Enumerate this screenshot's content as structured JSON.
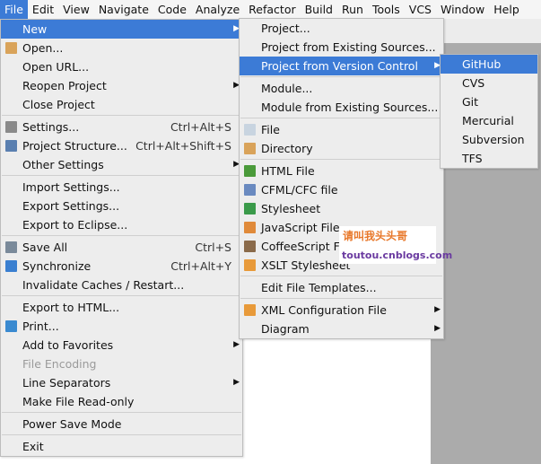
{
  "menubar": [
    "File",
    "Edit",
    "View",
    "Navigate",
    "Code",
    "Analyze",
    "Refactor",
    "Build",
    "Run",
    "Tools",
    "VCS",
    "Window",
    "Help"
  ],
  "active_menu": "File",
  "colors": {
    "selection": "#3c7bd6",
    "menu_bg": "#ededed"
  },
  "file_menu": [
    {
      "label": "New",
      "submenu": true,
      "selected": true
    },
    {
      "label": "Open...",
      "icon": "folder-icon"
    },
    {
      "label": "Open URL..."
    },
    {
      "label": "Reopen Project",
      "submenu": true
    },
    {
      "label": "Close Project"
    },
    {
      "sep": true
    },
    {
      "label": "Settings...",
      "icon": "wrench-icon",
      "shortcut": "Ctrl+Alt+S"
    },
    {
      "label": "Project Structure...",
      "icon": "project-structure-icon",
      "shortcut": "Ctrl+Alt+Shift+S"
    },
    {
      "label": "Other Settings",
      "submenu": true
    },
    {
      "sep": true
    },
    {
      "label": "Import Settings..."
    },
    {
      "label": "Export Settings..."
    },
    {
      "label": "Export to Eclipse..."
    },
    {
      "sep": true
    },
    {
      "label": "Save All",
      "icon": "save-icon",
      "shortcut": "Ctrl+S"
    },
    {
      "label": "Synchronize",
      "icon": "sync-icon",
      "shortcut": "Ctrl+Alt+Y"
    },
    {
      "label": "Invalidate Caches / Restart..."
    },
    {
      "sep": true
    },
    {
      "label": "Export to HTML..."
    },
    {
      "label": "Print...",
      "icon": "print-icon"
    },
    {
      "label": "Add to Favorites",
      "submenu": true
    },
    {
      "label": "File Encoding",
      "disabled": true
    },
    {
      "label": "Line Separators",
      "submenu": true
    },
    {
      "label": "Make File Read-only"
    },
    {
      "sep": true
    },
    {
      "label": "Power Save Mode"
    },
    {
      "sep": true
    },
    {
      "label": "Exit"
    }
  ],
  "new_menu": [
    {
      "label": "Project..."
    },
    {
      "label": "Project from Existing Sources..."
    },
    {
      "label": "Project from Version Control",
      "submenu": true,
      "selected": true
    },
    {
      "sep": true
    },
    {
      "label": "Module..."
    },
    {
      "label": "Module from Existing Sources..."
    },
    {
      "sep": true
    },
    {
      "label": "File",
      "icon": "file-icon"
    },
    {
      "label": "Directory",
      "icon": "folder-icon"
    },
    {
      "sep": true
    },
    {
      "label": "HTML File",
      "icon": "html-file-icon"
    },
    {
      "label": "CFML/CFC file",
      "icon": "cfml-file-icon"
    },
    {
      "label": "Stylesheet",
      "icon": "css-file-icon"
    },
    {
      "label": "JavaScript File",
      "icon": "js-file-icon"
    },
    {
      "label": "CoffeeScript File",
      "icon": "coffeescript-file-icon"
    },
    {
      "label": "XSLT Stylesheet",
      "icon": "xslt-file-icon"
    },
    {
      "sep": true
    },
    {
      "label": "Edit File Templates..."
    },
    {
      "sep": true
    },
    {
      "label": "XML Configuration File",
      "icon": "xml-file-icon",
      "submenu": true
    },
    {
      "label": "Diagram",
      "submenu": true
    }
  ],
  "vcs_menu": [
    {
      "label": "GitHub",
      "selected": true
    },
    {
      "label": "CVS"
    },
    {
      "label": "Git"
    },
    {
      "label": "Mercurial"
    },
    {
      "label": "Subversion"
    },
    {
      "label": "TFS"
    }
  ],
  "watermark": {
    "line1": "请叫我头头哥",
    "line2": "toutou.cnblogs.com"
  }
}
